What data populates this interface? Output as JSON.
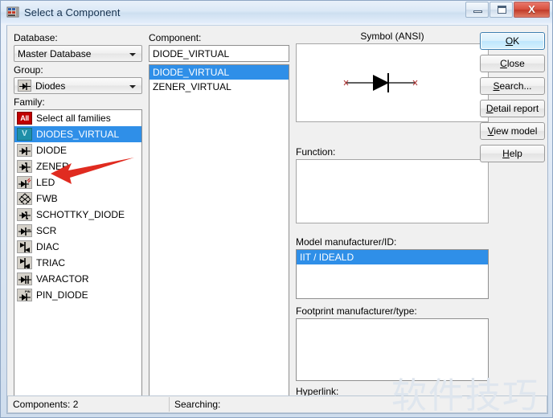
{
  "window": {
    "title": "Select a Component",
    "icon": "component-database-icon",
    "controls": {
      "minimize": "minimize-button",
      "restore": "restore-button",
      "close": "close-button",
      "close_glyph": "X"
    }
  },
  "left": {
    "database_label": "Database:",
    "database_value": "Master Database",
    "group_label": "Group:",
    "group_value": "Diodes",
    "family_label": "Family:",
    "families": [
      {
        "label": "Select all families",
        "icon": "all-families-icon",
        "selected": false,
        "icon_kind": "all"
      },
      {
        "label": "DIODES_VIRTUAL",
        "icon": "virtual-diode-icon",
        "selected": true,
        "icon_kind": "virtual"
      },
      {
        "label": "DIODE",
        "icon": "diode-icon",
        "selected": false,
        "icon_kind": "diode"
      },
      {
        "label": "ZENER",
        "icon": "zener-icon",
        "selected": false,
        "icon_kind": "zener"
      },
      {
        "label": "LED",
        "icon": "led-icon",
        "selected": false,
        "icon_kind": "led"
      },
      {
        "label": "FWB",
        "icon": "full-wave-bridge-icon",
        "selected": false,
        "icon_kind": "fwb"
      },
      {
        "label": "SCHOTTKY_DIODE",
        "icon": "schottky-diode-icon",
        "selected": false,
        "icon_kind": "schottky"
      },
      {
        "label": "SCR",
        "icon": "scr-icon",
        "selected": false,
        "icon_kind": "scr"
      },
      {
        "label": "DIAC",
        "icon": "diac-icon",
        "selected": false,
        "icon_kind": "diac"
      },
      {
        "label": "TRIAC",
        "icon": "triac-icon",
        "selected": false,
        "icon_kind": "triac"
      },
      {
        "label": "VARACTOR",
        "icon": "varactor-icon",
        "selected": false,
        "icon_kind": "varactor"
      },
      {
        "label": "PIN_DIODE",
        "icon": "pin-diode-icon",
        "selected": false,
        "icon_kind": "pin"
      }
    ]
  },
  "middle": {
    "component_label": "Component:",
    "component_value": "DIODE_VIRTUAL",
    "components": [
      {
        "label": "DIODE_VIRTUAL",
        "selected": true
      },
      {
        "label": "ZENER_VIRTUAL",
        "selected": false
      }
    ]
  },
  "right": {
    "symbol_label": "Symbol (ANSI)",
    "symbol_graphic": "diode-symbol",
    "function_label": "Function:",
    "function_value": "",
    "model_label": "Model manufacturer/ID:",
    "model_items": [
      {
        "label": "IIT / IDEALD",
        "selected": true
      }
    ],
    "footprint_label": "Footprint manufacturer/type:",
    "footprint_items": [],
    "hyperlink_label": "Hyperlink:",
    "hyperlink_value": ""
  },
  "buttons": [
    {
      "name": "ok-button",
      "label": "OK",
      "mnemonic": "O",
      "primary": true
    },
    {
      "name": "close-button",
      "label": "Close",
      "mnemonic": "C",
      "primary": false
    },
    {
      "name": "search-button",
      "label": "Search...",
      "mnemonic": "S",
      "primary": false
    },
    {
      "name": "detail-report-button",
      "label": "Detail report",
      "mnemonic": "D",
      "primary": false
    },
    {
      "name": "view-model-button",
      "label": "View model",
      "mnemonic": "V",
      "primary": false
    },
    {
      "name": "help-button",
      "label": "Help",
      "mnemonic": "H",
      "primary": false
    }
  ],
  "statusbar": {
    "components_text": "Components: 2",
    "searching_text": "Searching:"
  },
  "annotation": {
    "arrow": "red-arrow-pointing-to-led",
    "color": "#e02b20"
  },
  "watermark": {
    "text": "软件技巧",
    "color": "#dfe6ee"
  },
  "colors": {
    "selection_blue": "#2f8fe8",
    "title_blue": "#16324f",
    "dialog_face": "#f0f0f0"
  }
}
